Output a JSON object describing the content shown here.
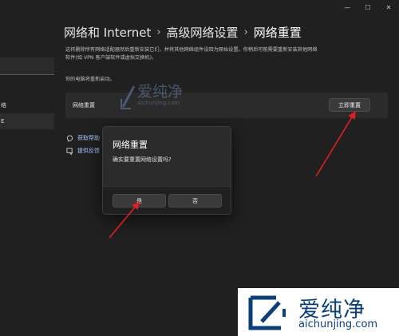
{
  "window": {
    "minimize_glyph": "—",
    "maximize_glyph": "☐",
    "close_glyph": "✕"
  },
  "sidebar": {
    "items": [
      {
        "label": "络"
      },
      {
        "label": "E"
      }
    ]
  },
  "breadcrumb": {
    "items": [
      "网络和 Internet",
      "高级网络设置",
      "网络重置"
    ],
    "separator": "›"
  },
  "description": {
    "line1": "这将删除所有网络适配器然后重新安装它们，并将其他网络组件设回为原始设置。你稍后可能需要重新安装其他网络",
    "line2": "软件(如 VPN 客户端软件或虚拟交换机)。",
    "restart_note": "你的电脑将重新启动。"
  },
  "reset_card": {
    "label": "网络重置",
    "button_label": "立即重置"
  },
  "links": [
    {
      "label": "获取帮助",
      "icon": "help-icon"
    },
    {
      "label": "提供反馈",
      "icon": "feedback-icon"
    }
  ],
  "dialog": {
    "title": "网络重置",
    "message": "确实要重置网络设置吗?",
    "yes_label": "是",
    "no_label": "否"
  },
  "watermark": {
    "mid_text": "爱纯净",
    "mid_url": "aichunjing.com",
    "corner_text": "爱纯净",
    "corner_url": "aichunjing.com"
  },
  "colors": {
    "background": "#202020",
    "card": "#2b2b2b",
    "arrow": "#e02020",
    "link": "#a8c8ff"
  }
}
